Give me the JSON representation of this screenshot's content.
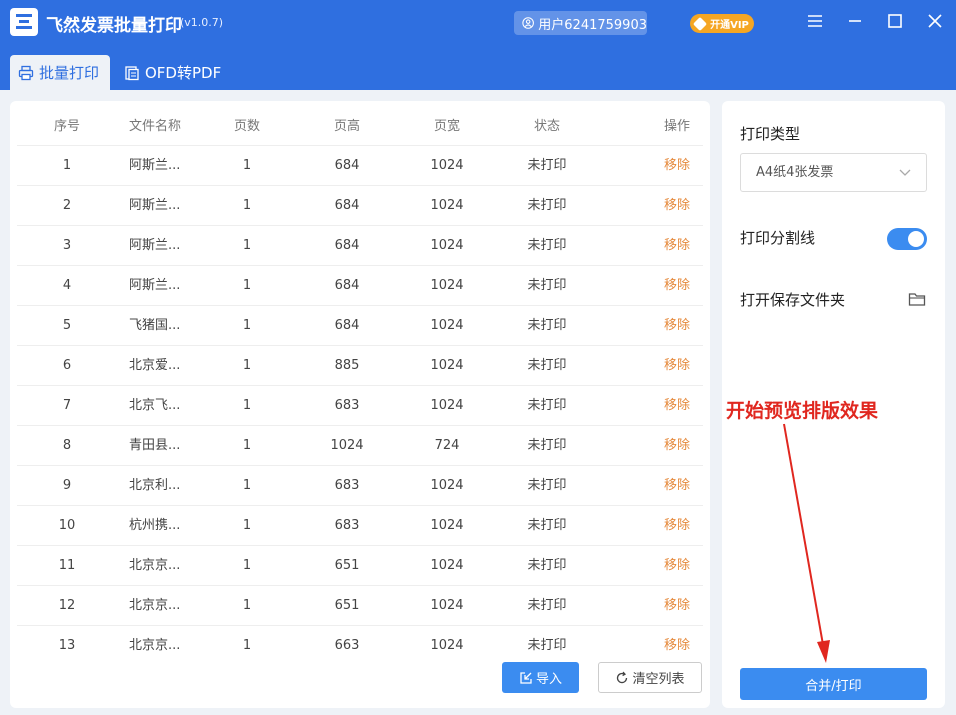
{
  "app": {
    "title": "飞然发票批量打印",
    "version": "(v1.0.7)",
    "user": "用户6241759903",
    "vip": "开通VIP"
  },
  "tabs": [
    {
      "label": "批量打印",
      "icon": "printer-icon",
      "active": true
    },
    {
      "label": "OFD转PDF",
      "icon": "document-convert-icon",
      "active": false
    }
  ],
  "table": {
    "headers": {
      "index": "序号",
      "name": "文件名称",
      "pages": "页数",
      "height": "页高",
      "width": "页宽",
      "status": "状态",
      "action": "操作"
    },
    "rows": [
      {
        "index": "1",
        "name": "阿斯兰...",
        "pages": "1",
        "height": "684",
        "width": "1024",
        "status": "未打印",
        "action": "移除"
      },
      {
        "index": "2",
        "name": "阿斯兰...",
        "pages": "1",
        "height": "684",
        "width": "1024",
        "status": "未打印",
        "action": "移除"
      },
      {
        "index": "3",
        "name": "阿斯兰...",
        "pages": "1",
        "height": "684",
        "width": "1024",
        "status": "未打印",
        "action": "移除"
      },
      {
        "index": "4",
        "name": "阿斯兰...",
        "pages": "1",
        "height": "684",
        "width": "1024",
        "status": "未打印",
        "action": "移除"
      },
      {
        "index": "5",
        "name": "飞猪国...",
        "pages": "1",
        "height": "684",
        "width": "1024",
        "status": "未打印",
        "action": "移除"
      },
      {
        "index": "6",
        "name": "北京爱...",
        "pages": "1",
        "height": "885",
        "width": "1024",
        "status": "未打印",
        "action": "移除"
      },
      {
        "index": "7",
        "name": "北京飞...",
        "pages": "1",
        "height": "683",
        "width": "1024",
        "status": "未打印",
        "action": "移除"
      },
      {
        "index": "8",
        "name": "青田县...",
        "pages": "1",
        "height": "1024",
        "width": "724",
        "status": "未打印",
        "action": "移除"
      },
      {
        "index": "9",
        "name": "北京利...",
        "pages": "1",
        "height": "683",
        "width": "1024",
        "status": "未打印",
        "action": "移除"
      },
      {
        "index": "10",
        "name": "杭州携...",
        "pages": "1",
        "height": "683",
        "width": "1024",
        "status": "未打印",
        "action": "移除"
      },
      {
        "index": "11",
        "name": "北京京...",
        "pages": "1",
        "height": "651",
        "width": "1024",
        "status": "未打印",
        "action": "移除"
      },
      {
        "index": "12",
        "name": "北京京...",
        "pages": "1",
        "height": "651",
        "width": "1024",
        "status": "未打印",
        "action": "移除"
      },
      {
        "index": "13",
        "name": "北京京...",
        "pages": "1",
        "height": "663",
        "width": "1024",
        "status": "未打印",
        "action": "移除"
      }
    ]
  },
  "buttons": {
    "import": "导入",
    "clear": "清空列表",
    "merge_print": "合并/打印"
  },
  "settings": {
    "print_type_label": "打印类型",
    "print_type_value": "A4纸4张发票",
    "divider_label": "打印分割线",
    "divider_enabled": true,
    "open_folder_label": "打开保存文件夹"
  },
  "annotation": {
    "text": "开始预览排版效果"
  },
  "colors": {
    "brand": "#2f6fe0",
    "button": "#3b8cf0",
    "remove": "#e5893b",
    "vip": "#f5a623",
    "annotation": "#e0271f"
  }
}
